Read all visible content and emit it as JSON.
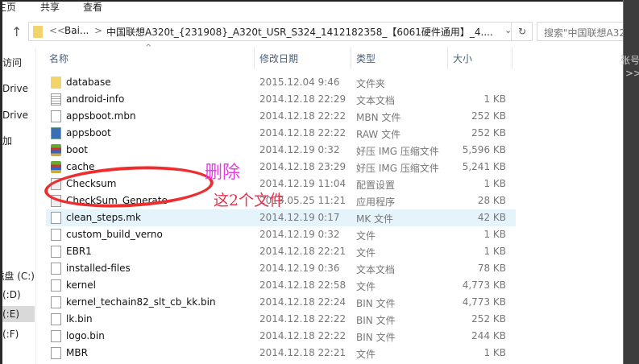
{
  "ribbon": {
    "tabs": [
      "主页",
      "共享",
      "查看"
    ]
  },
  "address": {
    "back_more": "<<",
    "crumb1": "Bai...",
    "sep": ">",
    "path": "中国联想A320t_{231908}_A320t_USR_S324_1412182358_【6061硬件通用】_4....",
    "search_placeholder": "搜索\"中国联想A32"
  },
  "nav": {
    "items": [
      "访问",
      "Drive",
      "Drive",
      "加",
      "磁盘 (C:)",
      "(D:)",
      "(E:)",
      "(F:)"
    ]
  },
  "columns": {
    "name": "名称",
    "date": "修改日期",
    "type": "类型",
    "size": "大小"
  },
  "right_strip": {
    "t1": "张号",
    "t2": ">>"
  },
  "annotation": {
    "line1": "删除",
    "line2": "这2个文件"
  },
  "files": [
    {
      "icon": "folder",
      "name": "database",
      "date": "2015.12.04 9:46",
      "type": "文件夹",
      "size": ""
    },
    {
      "icon": "doc",
      "name": "android-info",
      "date": "2014.12.18 22:29",
      "type": "文本文档",
      "size": "1 KB"
    },
    {
      "icon": "file",
      "name": "appsboot.mbn",
      "date": "2014.12.18 22:22",
      "type": "MBN 文件",
      "size": "252 KB"
    },
    {
      "icon": "img",
      "name": "appsboot",
      "date": "2014.12.18 22:22",
      "type": "RAW 文件",
      "size": "252 KB"
    },
    {
      "icon": "rar",
      "name": "boot",
      "date": "2014.12.19 0:32",
      "type": "好压 IMG 压缩文件",
      "size": "5,596 KB"
    },
    {
      "icon": "rar",
      "name": "cache",
      "date": "2014.12.18 23:29",
      "type": "好压 IMG 压缩文件",
      "size": "5,241 KB"
    },
    {
      "icon": "cfg",
      "name": "Checksum",
      "date": "2014.12.19 11:04",
      "type": "配置设置",
      "size": "1 KB"
    },
    {
      "icon": "cfg",
      "name": "CheckSum_Generate",
      "date": "2013.05.25 11:21",
      "type": "应用程序",
      "size": "28 KB"
    },
    {
      "icon": "file",
      "name": "clean_steps.mk",
      "date": "2014.12.19 0:17",
      "type": "MK 文件",
      "size": "42 KB"
    },
    {
      "icon": "file",
      "name": "custom_build_verno",
      "date": "2014.12.19 0:32",
      "type": "文件",
      "size": "1 KB"
    },
    {
      "icon": "file",
      "name": "EBR1",
      "date": "2014.12.18 22:21",
      "type": "文件",
      "size": "1 KB"
    },
    {
      "icon": "file",
      "name": "installed-files",
      "date": "2014.12.19 0:36",
      "type": "文本文档",
      "size": "78 KB"
    },
    {
      "icon": "file",
      "name": "kernel",
      "date": "2014.12.18 22:58",
      "type": "文件",
      "size": "4,773 KB"
    },
    {
      "icon": "file",
      "name": "kernel_techain82_slt_cb_kk.bin",
      "date": "2014.12.18 22:24",
      "type": "BIN 文件",
      "size": "4,773 KB"
    },
    {
      "icon": "file",
      "name": "lk.bin",
      "date": "2014.12.18 22:22",
      "type": "BIN 文件",
      "size": "252 KB"
    },
    {
      "icon": "file",
      "name": "logo.bin",
      "date": "2014.12.18 22:22",
      "type": "BIN 文件",
      "size": "244 KB"
    },
    {
      "icon": "file",
      "name": "MBR",
      "date": "2014.12.18 22:21",
      "type": "文件",
      "size": "1 KB"
    }
  ]
}
